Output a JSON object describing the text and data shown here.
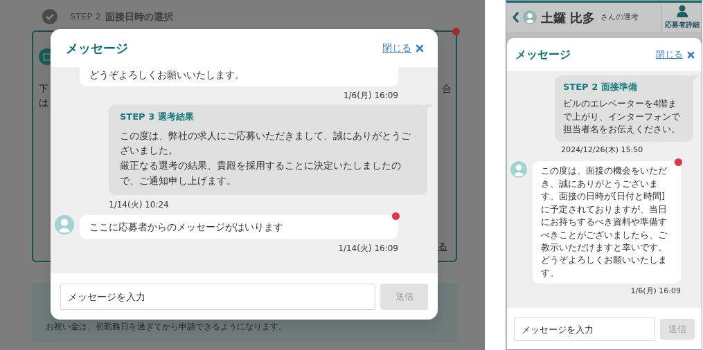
{
  "desktop": {
    "background": {
      "step_label": "STEP 2",
      "step_title": "面接日時の選択",
      "card_unread": true,
      "left_fragments": [
        "下",
        "は"
      ],
      "right_fragment": "合",
      "link_fragment": "る",
      "notice": "お祝い金は、初勤務日を過ぎてから申請できるようになります。"
    },
    "modal": {
      "title": "メッセージ",
      "close_label": "閉じる",
      "messages": [
        {
          "kind": "applicant",
          "avatar": false,
          "unread": false,
          "text": "どうぞよろしくお願いいたします。",
          "time": "1/6(月) 16:09"
        },
        {
          "kind": "company",
          "title": "STEP 3 選考結果",
          "paragraphs": [
            "この度は、弊社の求人にご応募いただきまして、誠にありがとうございました。",
            "厳正なる選考の結果、貴殿を採用することに決定いたしましたので、ご通知申し上げます。"
          ],
          "time": "1/14(火) 10:24"
        },
        {
          "kind": "applicant",
          "avatar": true,
          "unread": true,
          "text": "ここに応募者からのメッセージがはいります",
          "time": "1/14(火) 16:09"
        }
      ],
      "input": {
        "placeholder": "メッセージを入力"
      },
      "send": {
        "label": "送信",
        "disabled": true
      }
    }
  },
  "mobile": {
    "header": {
      "name": "土鑼 比多",
      "suffix": "さんの選考",
      "details_label": "応募者詳細"
    },
    "modal": {
      "title": "メッセージ",
      "close_label": "閉じる",
      "messages": [
        {
          "kind": "company",
          "title": "STEP 2 面接準備",
          "paragraphs": [
            "ビルのエレベーターを4階まで上がり、インターフォンで担当者名をお伝えください。"
          ],
          "time": "2024/12/26(木) 15:50"
        },
        {
          "kind": "applicant",
          "avatar": true,
          "unread": true,
          "text": "この度は、面接の機会をいただき、誠にありがとうございます。面接の日時が[日付と時間]に予定されておりますが、当日にお持ちするべき資料や準備すべきことがございましたら、ご教示いただけますと幸いです。どうぞよろしくお願いいたします。",
          "time": "1/6(月) 16:09"
        }
      ],
      "input": {
        "placeholder": "メッセージを入力"
      },
      "send": {
        "label": "送信",
        "disabled": true
      }
    }
  }
}
